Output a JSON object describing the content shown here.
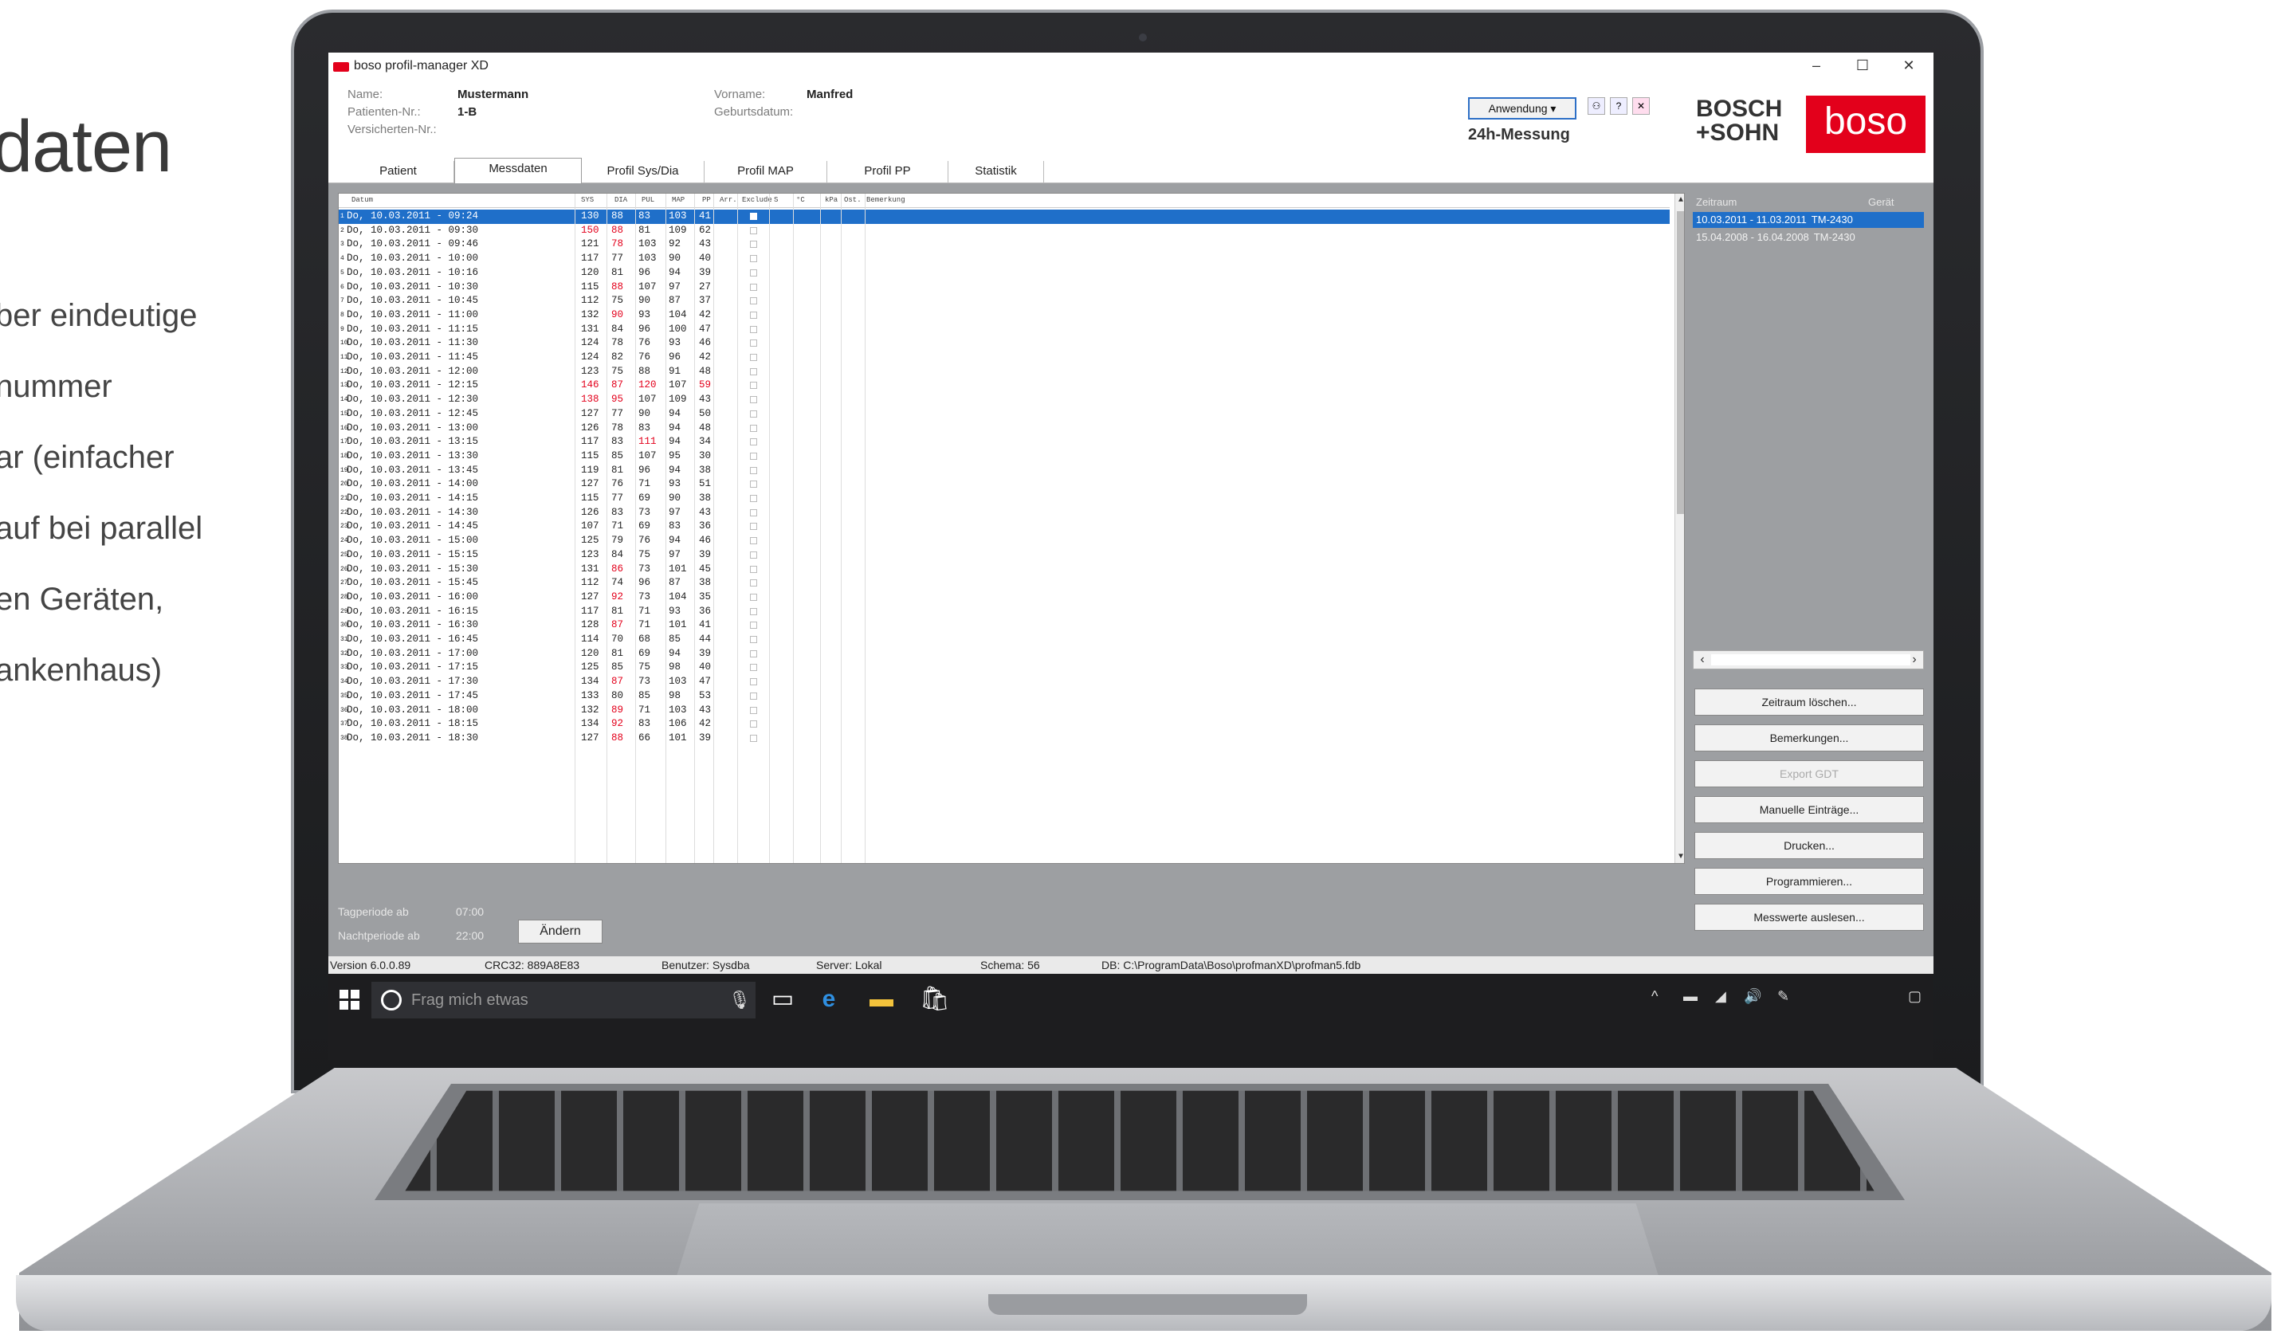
{
  "left_panel": {
    "heading": "daten",
    "lines": [
      "ber eindeutige",
      "nummer",
      "ar (einfacher",
      "auf bei parallel",
      "en Geräten,",
      "ankenhaus)"
    ]
  },
  "app": {
    "title": "boso profil-manager XD",
    "window_controls": {
      "minimize": "–",
      "maximize": "☐",
      "close": "✕"
    },
    "patient": {
      "name_label": "Name:",
      "name_value": "Mustermann",
      "patnr_label": "Patienten-Nr.:",
      "patnr_value": "1-B",
      "versnr_label": "Versicherten-Nr.:",
      "vorname_label": "Vorname:",
      "vorname_value": "Manfred",
      "geburt_label": "Geburtsdatum:"
    },
    "anwendung_button": "Anwendung ▾",
    "mode": "24h-Messung",
    "brand": {
      "bosch_line1": "BOSCH",
      "bosch_line2": "+SOHN",
      "boso": "boso",
      "color": "#e3001b"
    },
    "tabs": [
      "Patient",
      "Messdaten",
      "Profil Sys/Dia",
      "Profil MAP",
      "Profil PP",
      "Statistik"
    ],
    "active_tab": "Messdaten",
    "table": {
      "headers": [
        "Datum",
        "SYS",
        "DIA",
        "PUL",
        "MAP",
        "PP",
        "Arr.",
        "Exclude",
        "S",
        "°C",
        "kPa",
        "Ost.",
        "Bemerkung"
      ],
      "rows": [
        [
          "Do, 10.03.2011 - 09:24",
          "130",
          "88",
          "83",
          "103",
          "41"
        ],
        [
          "Do, 10.03.2011 - 09:30",
          "150",
          "88",
          "81",
          "109",
          "62"
        ],
        [
          "Do, 10.03.2011 - 09:46",
          "121",
          "78",
          "103",
          "92",
          "43"
        ],
        [
          "Do, 10.03.2011 - 10:00",
          "117",
          "77",
          "103",
          "90",
          "40"
        ],
        [
          "Do, 10.03.2011 - 10:16",
          "120",
          "81",
          "96",
          "94",
          "39"
        ],
        [
          "Do, 10.03.2011 - 10:30",
          "115",
          "88",
          "107",
          "97",
          "27"
        ],
        [
          "Do, 10.03.2011 - 10:45",
          "112",
          "75",
          "90",
          "87",
          "37"
        ],
        [
          "Do, 10.03.2011 - 11:00",
          "132",
          "90",
          "93",
          "104",
          "42"
        ],
        [
          "Do, 10.03.2011 - 11:15",
          "131",
          "84",
          "96",
          "100",
          "47"
        ],
        [
          "Do, 10.03.2011 - 11:30",
          "124",
          "78",
          "76",
          "93",
          "46"
        ],
        [
          "Do, 10.03.2011 - 11:45",
          "124",
          "82",
          "76",
          "96",
          "42"
        ],
        [
          "Do, 10.03.2011 - 12:00",
          "123",
          "75",
          "88",
          "91",
          "48"
        ],
        [
          "Do, 10.03.2011 - 12:15",
          "146",
          "87",
          "120",
          "107",
          "59"
        ],
        [
          "Do, 10.03.2011 - 12:30",
          "138",
          "95",
          "107",
          "109",
          "43"
        ],
        [
          "Do, 10.03.2011 - 12:45",
          "127",
          "77",
          "90",
          "94",
          "50"
        ],
        [
          "Do, 10.03.2011 - 13:00",
          "126",
          "78",
          "83",
          "94",
          "48"
        ],
        [
          "Do, 10.03.2011 - 13:15",
          "117",
          "83",
          "111",
          "94",
          "34"
        ],
        [
          "Do, 10.03.2011 - 13:30",
          "115",
          "85",
          "107",
          "95",
          "30"
        ],
        [
          "Do, 10.03.2011 - 13:45",
          "119",
          "81",
          "96",
          "94",
          "38"
        ],
        [
          "Do, 10.03.2011 - 14:00",
          "127",
          "76",
          "71",
          "93",
          "51"
        ],
        [
          "Do, 10.03.2011 - 14:15",
          "115",
          "77",
          "69",
          "90",
          "38"
        ],
        [
          "Do, 10.03.2011 - 14:30",
          "126",
          "83",
          "73",
          "97",
          "43"
        ],
        [
          "Do, 10.03.2011 - 14:45",
          "107",
          "71",
          "69",
          "83",
          "36"
        ],
        [
          "Do, 10.03.2011 - 15:00",
          "125",
          "79",
          "76",
          "94",
          "46"
        ],
        [
          "Do, 10.03.2011 - 15:15",
          "123",
          "84",
          "75",
          "97",
          "39"
        ],
        [
          "Do, 10.03.2011 - 15:30",
          "131",
          "86",
          "73",
          "101",
          "45"
        ],
        [
          "Do, 10.03.2011 - 15:45",
          "112",
          "74",
          "96",
          "87",
          "38"
        ],
        [
          "Do, 10.03.2011 - 16:00",
          "127",
          "92",
          "73",
          "104",
          "35"
        ],
        [
          "Do, 10.03.2011 - 16:15",
          "117",
          "81",
          "71",
          "93",
          "36"
        ],
        [
          "Do, 10.03.2011 - 16:30",
          "128",
          "87",
          "71",
          "101",
          "41"
        ],
        [
          "Do, 10.03.2011 - 16:45",
          "114",
          "70",
          "68",
          "85",
          "44"
        ],
        [
          "Do, 10.03.2011 - 17:00",
          "120",
          "81",
          "69",
          "94",
          "39"
        ],
        [
          "Do, 10.03.2011 - 17:15",
          "125",
          "85",
          "75",
          "98",
          "40"
        ],
        [
          "Do, 10.03.2011 - 17:30",
          "134",
          "87",
          "73",
          "103",
          "47"
        ],
        [
          "Do, 10.03.2011 - 17:45",
          "133",
          "80",
          "85",
          "98",
          "53"
        ],
        [
          "Do, 10.03.2011 - 18:00",
          "132",
          "89",
          "71",
          "103",
          "43"
        ],
        [
          "Do, 10.03.2011 - 18:15",
          "134",
          "92",
          "83",
          "106",
          "42"
        ],
        [
          "Do, 10.03.2011 - 18:30",
          "127",
          "88",
          "66",
          "101",
          "39"
        ]
      ],
      "red_cells": {
        "1": [
          1,
          2
        ],
        "2": [
          2
        ],
        "5": [
          2
        ],
        "7": [
          2
        ],
        "12": [
          1,
          2,
          3,
          5
        ],
        "13": [
          1,
          2
        ],
        "16": [
          3
        ],
        "25": [
          2
        ],
        "27": [
          2
        ],
        "29": [
          2
        ],
        "33": [
          2
        ],
        "35": [
          2
        ],
        "36": [
          2
        ],
        "37": [
          2
        ]
      },
      "selected_row": 0
    },
    "periods": {
      "tag_label": "Tagperiode ab",
      "tag_value": "07:00",
      "nacht_label": "Nachtperiode ab",
      "nacht_value": "22:00",
      "aendern_button": "Ändern"
    },
    "side": {
      "col_zeitraum": "Zeitraum",
      "col_geraet": "Gerät",
      "rows": [
        {
          "zeitraum": "10.03.2011 - 11.03.2011",
          "geraet": "TM-2430"
        },
        {
          "zeitraum": "15.04.2008 - 16.04.2008",
          "geraet": "TM-2430"
        }
      ],
      "buttons": [
        "Zeitraum löschen...",
        "Bemerkungen...",
        "Export GDT",
        "Manuelle Einträge...",
        "Drucken...",
        "Programmieren...",
        "Messwerte auslesen..."
      ],
      "disabled_button": "Export GDT"
    },
    "status": {
      "version": "Version 6.0.0.89",
      "crc": "CRC32: 889A8E83",
      "benutzer": "Benutzer: Sysdba",
      "server": "Server: Lokal",
      "schema": "Schema: 56",
      "db": "DB: C:\\ProgramData\\Boso\\profmanXD\\profman5.fdb"
    },
    "taskbar": {
      "search_placeholder": "Frag mich etwas"
    }
  }
}
